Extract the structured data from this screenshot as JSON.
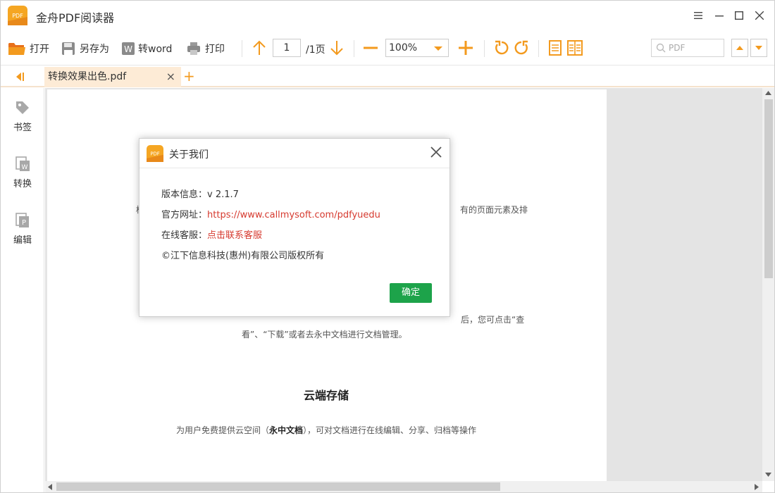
{
  "app": {
    "title": "金舟PDF阅读器",
    "logo_text": "PDF"
  },
  "toolbar": {
    "open_label": "打开",
    "save_as_label": "另存为",
    "to_word_label": "转word",
    "print_label": "打印",
    "page_current": "1",
    "page_total": "/1页",
    "zoom_value": "100%",
    "search_placeholder": "PDF"
  },
  "tabs": [
    {
      "label": "转换效果出色.pdf",
      "close": "×"
    }
  ],
  "tab_add": "+",
  "sidebar": {
    "items": [
      {
        "label": "书签",
        "icon": "bookmark-icon"
      },
      {
        "label": "转换",
        "icon": "convert-icon"
      },
      {
        "label": "编辑",
        "icon": "edit-icon"
      }
    ]
  },
  "document": {
    "fragment_left": "档",
    "fragment_right": "有的页面元素及排",
    "para_line1_right": "后，您可点击“查",
    "para_line2": "看”、“下载”或者去永中文档进行文档管理。",
    "heading": "云端存储",
    "line_prefix": "为用户免费提供云空间（",
    "line_bold": "永中文档",
    "line_suffix": "），可对文档进行在线编辑、分享、归档等操作"
  },
  "modal": {
    "title": "关于我们",
    "version_label": "版本信息：",
    "version_value": "v 2.1.7",
    "website_label": "官方网址：",
    "website_value": "https://www.callmysoft.com/pdfyuedu",
    "support_label": "在线客服：",
    "support_value": "点击联系客服",
    "copyright": "©江下信息科技(惠州)有限公司版权所有",
    "ok_label": "确定"
  },
  "colors": {
    "accent": "#f39a1e",
    "link": "#d63a2f",
    "ok": "#1da34a"
  }
}
